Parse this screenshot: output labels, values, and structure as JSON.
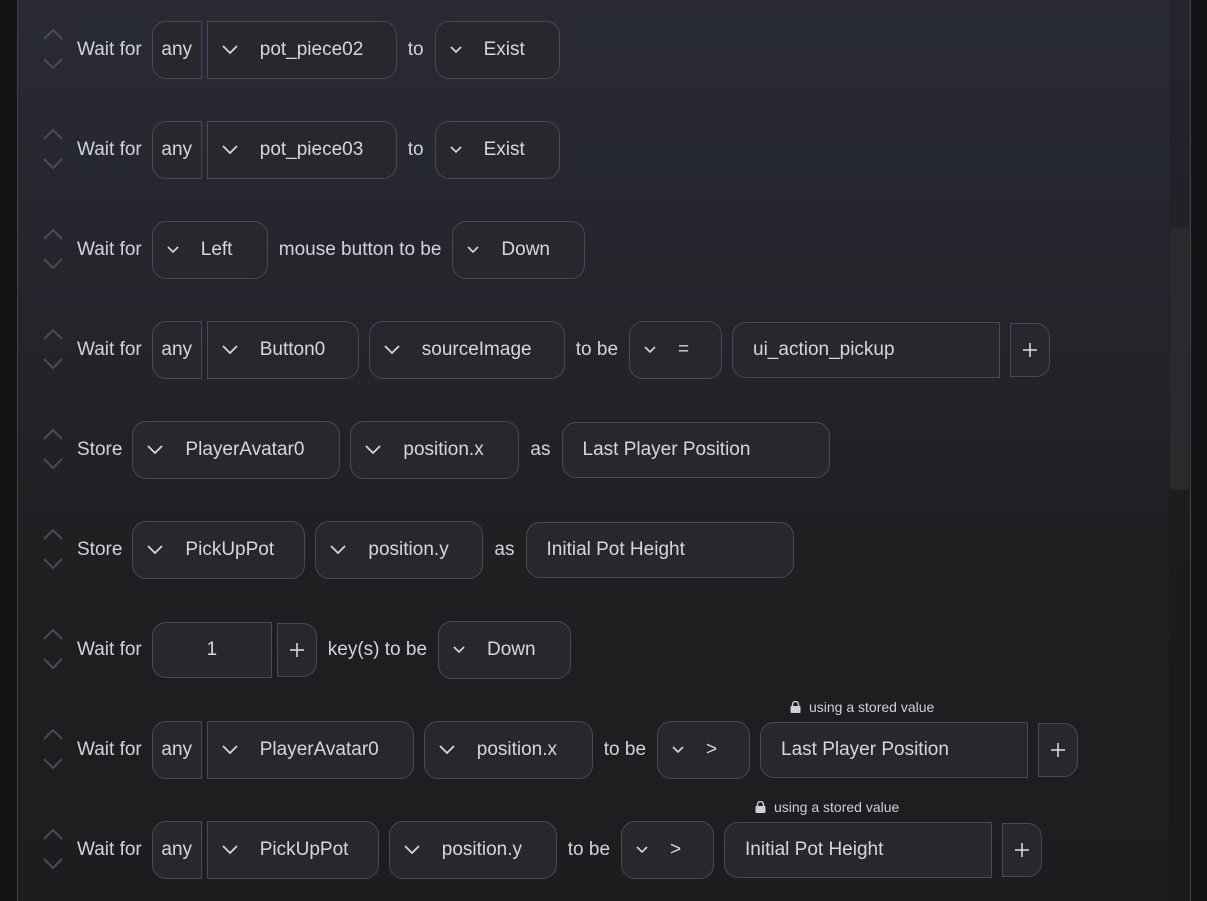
{
  "colors": {
    "panel_border": "#3c4150",
    "control_bg": "#27282e",
    "control_border": "#454a57",
    "text": "#d6d7dc",
    "reorder_icon": "#4a4c52"
  },
  "rows": [
    {
      "verb": "Wait for",
      "quantifier": "any",
      "object": "pot_piece02",
      "connector": "to",
      "state": "Exist"
    },
    {
      "verb": "Wait for",
      "quantifier": "any",
      "object": "pot_piece03",
      "connector": "to",
      "state": "Exist"
    },
    {
      "verb": "Wait for",
      "button": "Left",
      "connector": "mouse button to be",
      "state": "Down"
    },
    {
      "verb": "Wait for",
      "quantifier": "any",
      "object": "Button0",
      "property": "sourceImage",
      "connector": "to be",
      "operator": "=",
      "value": "ui_action_pickup"
    },
    {
      "verb": "Store",
      "object": "PlayerAvatar0",
      "property": "position.x",
      "connector": "as",
      "name": "Last Player Position"
    },
    {
      "verb": "Store",
      "object": "PickUpPot",
      "property": "position.y",
      "connector": "as",
      "name": "Initial Pot Height"
    },
    {
      "verb": "Wait for",
      "count": "1",
      "connector": "key(s) to be",
      "state": "Down"
    },
    {
      "verb": "Wait for",
      "quantifier": "any",
      "object": "PlayerAvatar0",
      "property": "position.x",
      "connector": "to be",
      "operator": ">",
      "value": "Last Player Position",
      "hint": "using a stored value"
    },
    {
      "verb": "Wait for",
      "quantifier": "any",
      "object": "PickUpPot",
      "property": "position.y",
      "connector": "to be",
      "operator": ">",
      "value": "Initial Pot Height",
      "hint": "using a stored value"
    }
  ]
}
